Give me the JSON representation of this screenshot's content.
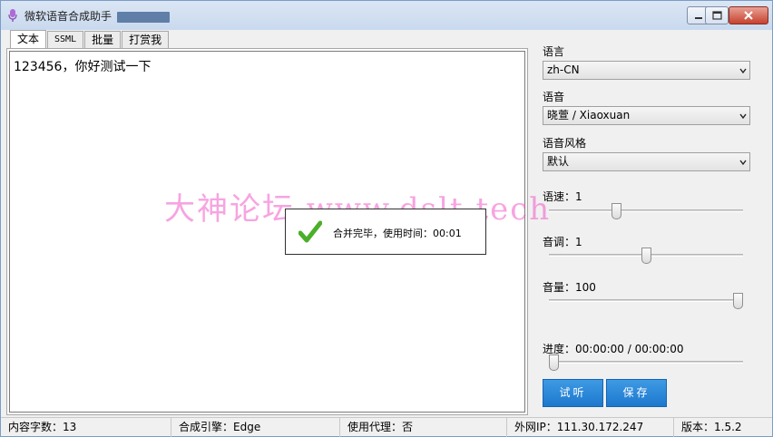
{
  "window": {
    "title": "微软语音合成助手"
  },
  "tabs": [
    {
      "label": "文本"
    },
    {
      "label": "SSML"
    },
    {
      "label": "批量"
    },
    {
      "label": "打赏我"
    }
  ],
  "editor": {
    "text": "123456，你好测试一下"
  },
  "toast": {
    "message": "合并完毕，使用时间：00:01"
  },
  "watermark": {
    "text": "大神论坛  www.dslt.tech"
  },
  "right_panel": {
    "language_label": "语言",
    "language_value": "zh-CN",
    "voice_label": "语音",
    "voice_value": "晓萱 / Xiaoxuan",
    "style_label": "语音风格",
    "style_value": "默认",
    "rate_label": "语速：1",
    "rate_level": 0.34,
    "pitch_label": "音调：1",
    "pitch_level": 0.5,
    "volume_label": "音量：100",
    "volume_level": 1.0,
    "progress_label": "进度：00:00:00 / 00:00:00",
    "progress_level": 0.0,
    "listen_button": "试听",
    "save_button": "保存"
  },
  "statusbar": {
    "char_count": "内容字数：13",
    "engine": "合成引擎：Edge",
    "proxy": "使用代理：否",
    "ip": "外网IP：111.30.172.247",
    "version": "版本：1.5.2"
  },
  "colors": {
    "accent_button": "#2a86d8",
    "check_green": "#4caf2a",
    "watermark": "#f05ac8"
  }
}
